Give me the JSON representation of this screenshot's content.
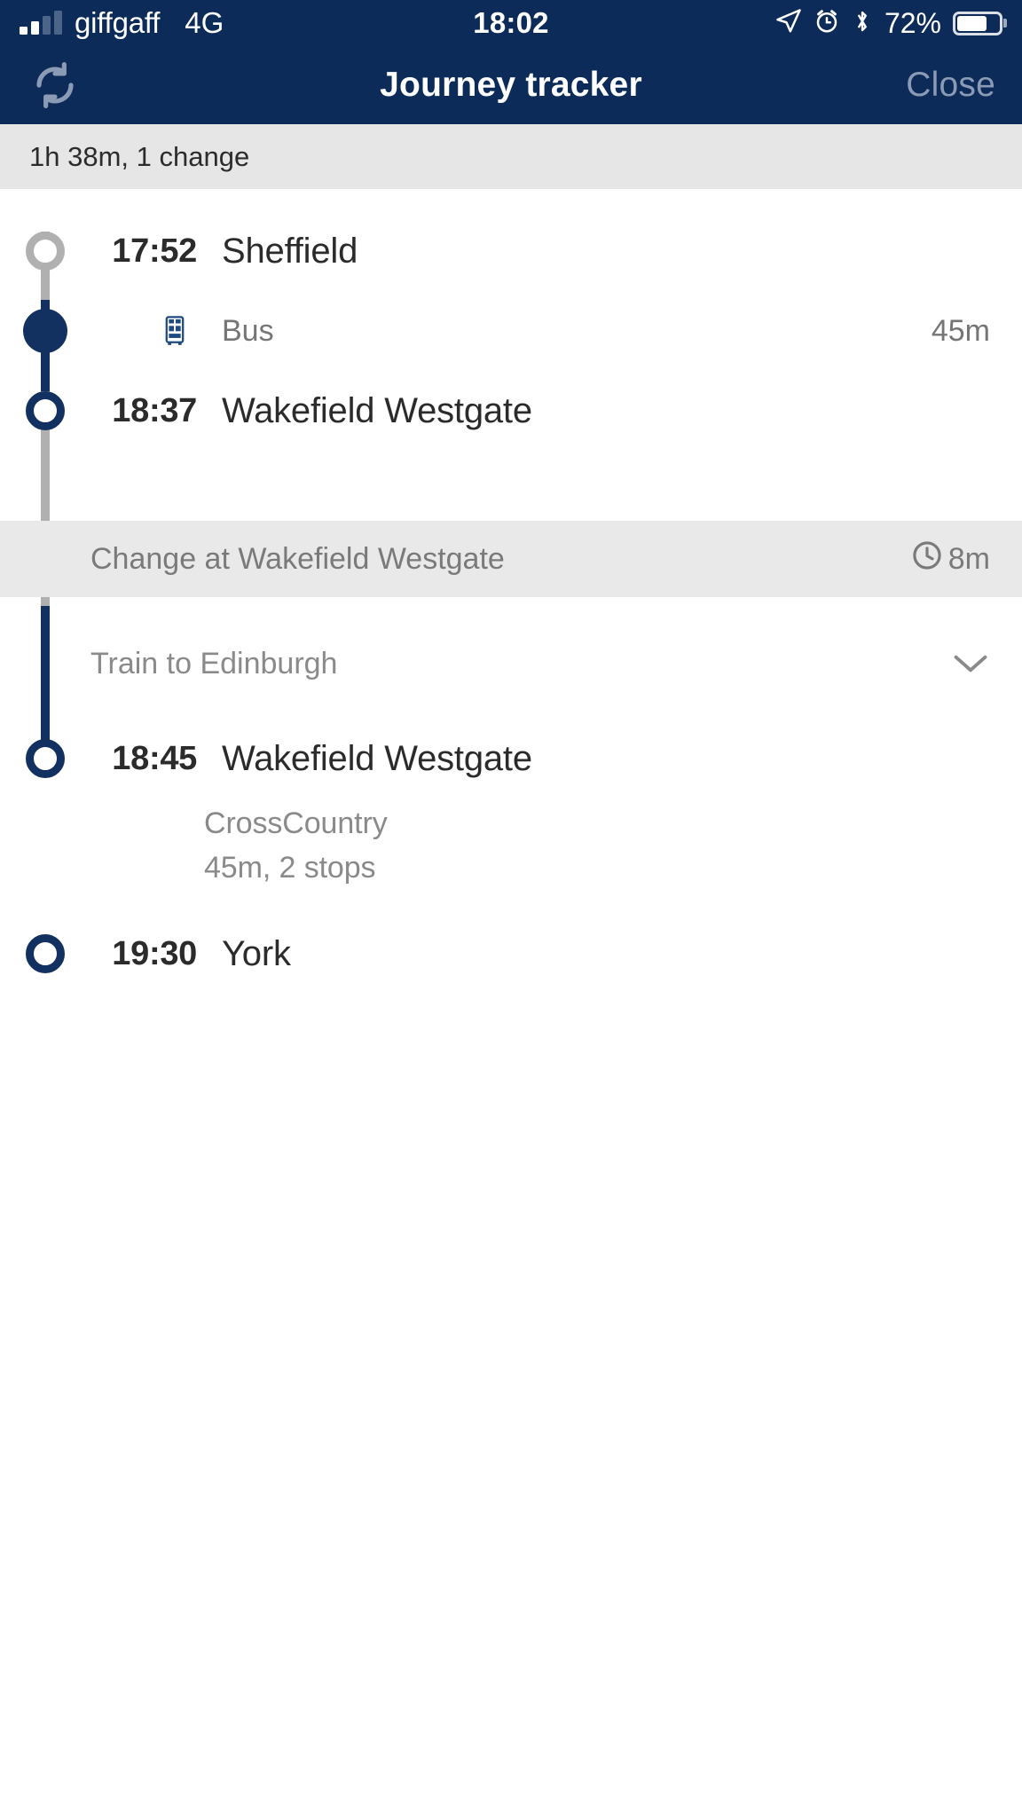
{
  "status_bar": {
    "carrier": "giffgaff",
    "network": "4G",
    "time": "18:02",
    "battery_percent": "72%",
    "icons": [
      "signal-bars-icon",
      "location-arrow-icon",
      "alarm-clock-icon",
      "bluetooth-icon",
      "battery-icon"
    ]
  },
  "nav_bar": {
    "refresh_icon": "refresh-icon",
    "title": "Journey tracker",
    "close_label": "Close"
  },
  "summary": {
    "text": "1h 38m, 1 change"
  },
  "legs": [
    {
      "id": "leg-1",
      "departure": {
        "time": "17:52",
        "station": "Sheffield"
      },
      "mode": {
        "icon": "bus-icon",
        "label": "Bus",
        "duration": "45m"
      },
      "arrival": {
        "time": "18:37",
        "station": "Wakefield Westgate"
      }
    },
    {
      "id": "leg-2",
      "operator_header": "Train to Edinburgh",
      "chevron": "chevron-down-icon",
      "departure": {
        "time": "18:45",
        "station": "Wakefield Westgate"
      },
      "details": [
        "CrossCountry",
        "45m, 2 stops"
      ],
      "arrival": {
        "time": "19:30",
        "station": "York"
      }
    }
  ],
  "change": {
    "text": "Change at Wakefield Westgate",
    "icon": "clock-icon",
    "duration": "8m"
  },
  "colors": {
    "brand_navy": "#0d2b59",
    "spine_navy": "#123160",
    "spine_grey": "#b0b0b0",
    "strip_grey": "#e6e6e6",
    "text_dark": "#2b2b2b",
    "text_muted": "#8a8a8a"
  }
}
